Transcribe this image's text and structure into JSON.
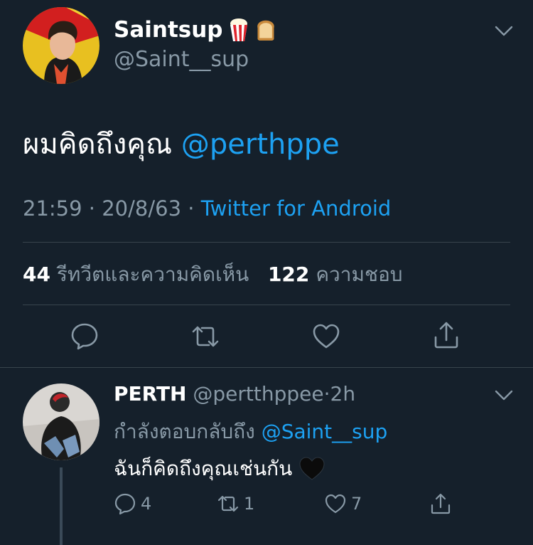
{
  "main_tweet": {
    "display_name": "Saintsup",
    "name_emojis": [
      "popcorn-emoji",
      "bread-emoji"
    ],
    "handle": "@Saint__sup",
    "text": "ผมคิดถึงคุณ",
    "mention": "@perthppe",
    "time": "21:59",
    "date": "20/8/63",
    "separator": "·",
    "source": "Twitter for Android",
    "stats": {
      "retweets_count": "44",
      "retweets_label": "รีทวีตและความคิดเห็น",
      "likes_count": "122",
      "likes_label": "ความชอบ"
    },
    "actions": [
      "reply",
      "retweet",
      "like",
      "share"
    ]
  },
  "reply_tweet": {
    "display_name": "PERTH",
    "handle": "@pertthppee",
    "separator": "·",
    "age": "2h",
    "replying_label": "กำลังตอบกลับถึง",
    "replying_to": "@Saint__sup",
    "text": "ฉันก็คิดถึงคุณเช่นกัน",
    "trailing_emoji": "black-heart-emoji",
    "reply_count": "4",
    "retweet_count": "1",
    "like_count": "7"
  },
  "colors": {
    "background": "#15202b",
    "accent": "#1da1f2",
    "secondary_text": "#8899a6",
    "divider": "#38444d"
  }
}
